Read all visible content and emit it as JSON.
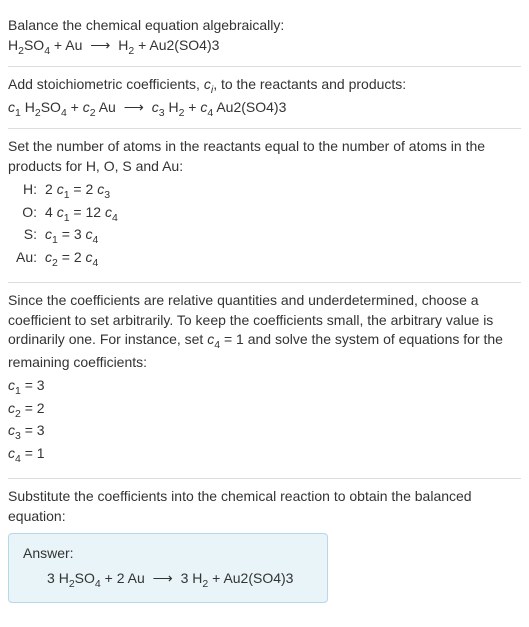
{
  "intro": {
    "title": "Balance the chemical equation algebraically:",
    "reaction": {
      "lhs1": "H",
      "lhs1_sub": "2",
      "lhs1b": "SO",
      "lhs1b_sub": "4",
      "plus1": " + ",
      "lhs2": "Au",
      "arrow": "⟶",
      "rhs1": "H",
      "rhs1_sub": "2",
      "plus2": " + ",
      "rhs2": "Au2(SO4)3"
    }
  },
  "step1": {
    "text_a": "Add stoichiometric coefficients, ",
    "var": "c",
    "var_sub": "i",
    "text_b": ", to the reactants and products:",
    "reaction": {
      "c1": "c",
      "c1_sub": "1",
      "sp1": " ",
      "r1a": "H",
      "r1a_sub": "2",
      "r1b": "SO",
      "r1b_sub": "4",
      "plus1": " + ",
      "c2": "c",
      "c2_sub": "2",
      "sp2": " ",
      "r2": "Au",
      "arrow": "⟶",
      "c3": "c",
      "c3_sub": "3",
      "sp3": " ",
      "p1": "H",
      "p1_sub": "2",
      "plus2": " + ",
      "c4": "c",
      "c4_sub": "4",
      "sp4": " ",
      "p2": "Au2(SO4)3"
    }
  },
  "step2": {
    "text": "Set the number of atoms in the reactants equal to the number of atoms in the products for H, O, S and Au:",
    "rows": [
      {
        "label": "H:",
        "lhs_n": "2 ",
        "lhs_v": "c",
        "lhs_s": "1",
        "eq": " = ",
        "rhs_n": "2 ",
        "rhs_v": "c",
        "rhs_s": "3"
      },
      {
        "label": "O:",
        "lhs_n": "4 ",
        "lhs_v": "c",
        "lhs_s": "1",
        "eq": " = ",
        "rhs_n": "12 ",
        "rhs_v": "c",
        "rhs_s": "4"
      },
      {
        "label": "S:",
        "lhs_n": "",
        "lhs_v": "c",
        "lhs_s": "1",
        "eq": " = ",
        "rhs_n": "3 ",
        "rhs_v": "c",
        "rhs_s": "4"
      },
      {
        "label": "Au:",
        "lhs_n": "",
        "lhs_v": "c",
        "lhs_s": "2",
        "eq": " = ",
        "rhs_n": "2 ",
        "rhs_v": "c",
        "rhs_s": "4"
      }
    ]
  },
  "step3": {
    "text_a": "Since the coefficients are relative quantities and underdetermined, choose a coefficient to set arbitrarily. To keep the coefficients small, the arbitrary value is ordinarily one. For instance, set ",
    "var": "c",
    "var_sub": "4",
    "eq": " = 1",
    "text_b": " and solve the system of equations for the remaining coefficients:",
    "coefs": [
      {
        "v": "c",
        "s": "1",
        "eq": " = 3"
      },
      {
        "v": "c",
        "s": "2",
        "eq": " = 2"
      },
      {
        "v": "c",
        "s": "3",
        "eq": " = 3"
      },
      {
        "v": "c",
        "s": "4",
        "eq": " = 1"
      }
    ]
  },
  "step4": {
    "text": "Substitute the coefficients into the chemical reaction to obtain the balanced equation:",
    "answer_label": "Answer:",
    "reaction": {
      "n1": "3 ",
      "r1a": "H",
      "r1a_sub": "2",
      "r1b": "SO",
      "r1b_sub": "4",
      "plus1": " + ",
      "n2": "2 ",
      "r2": "Au",
      "arrow": "⟶",
      "n3": "3 ",
      "p1": "H",
      "p1_sub": "2",
      "plus2": " + ",
      "p2": "Au2(SO4)3"
    }
  }
}
